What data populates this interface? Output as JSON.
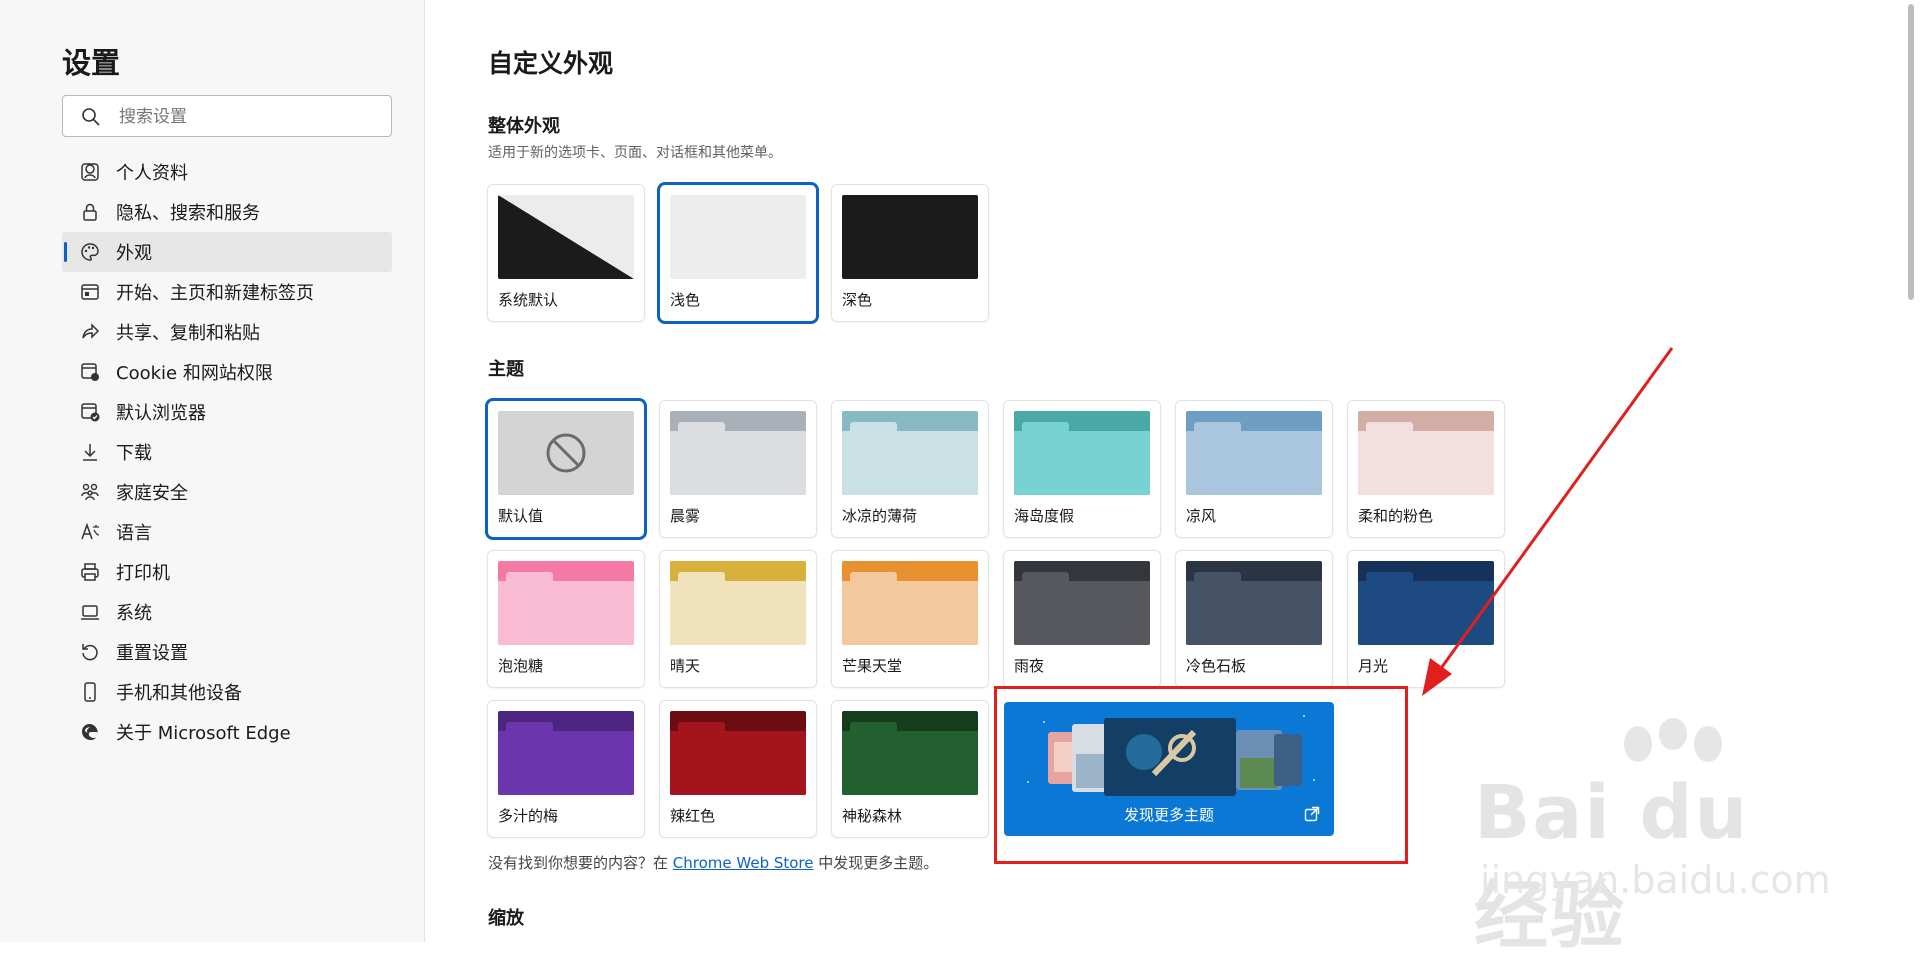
{
  "sidebar": {
    "title": "设置",
    "search_placeholder": "搜索设置",
    "items": [
      {
        "label": "个人资料",
        "icon": "profile-icon"
      },
      {
        "label": "隐私、搜索和服务",
        "icon": "lock-icon"
      },
      {
        "label": "外观",
        "icon": "palette-icon",
        "active": true
      },
      {
        "label": "开始、主页和新建标签页",
        "icon": "home-tab-icon"
      },
      {
        "label": "共享、复制和粘贴",
        "icon": "share-icon"
      },
      {
        "label": "Cookie 和网站权限",
        "icon": "cookie-permissions-icon"
      },
      {
        "label": "默认浏览器",
        "icon": "default-browser-icon"
      },
      {
        "label": "下载",
        "icon": "download-icon"
      },
      {
        "label": "家庭安全",
        "icon": "family-icon"
      },
      {
        "label": "语言",
        "icon": "language-icon"
      },
      {
        "label": "打印机",
        "icon": "printer-icon"
      },
      {
        "label": "系统",
        "icon": "system-icon"
      },
      {
        "label": "重置设置",
        "icon": "reset-icon"
      },
      {
        "label": "手机和其他设备",
        "icon": "phone-icon"
      },
      {
        "label": "关于 Microsoft Edge",
        "icon": "edge-logo-icon"
      }
    ]
  },
  "main": {
    "title": "自定义外观",
    "overall": {
      "title": "整体外观",
      "desc": "适用于新的选项卡、页面、对话框和其他菜单。",
      "options": [
        {
          "label": "系统默认"
        },
        {
          "label": "浅色",
          "selected": true
        },
        {
          "label": "深色"
        }
      ]
    },
    "themes": {
      "title": "主题",
      "items": [
        {
          "label": "默认值",
          "selected": true
        },
        {
          "label": "晨雾",
          "tab": "#aab0b7",
          "body": "#dcdde0"
        },
        {
          "label": "冰凉的薄荷",
          "tab": "#86b9c2",
          "body": "#c9e0e5"
        },
        {
          "label": "海岛度假",
          "tab": "#4aa9a5",
          "body": "#78d2d1"
        },
        {
          "label": "凉风",
          "tab": "#6e9ec4",
          "body": "#a9c6de"
        },
        {
          "label": "柔和的粉色",
          "tab": "#d3aea6",
          "body": "#f1e0df"
        },
        {
          "label": "泡泡糖",
          "tab": "#f47aa6",
          "body": "#f9bcd2"
        },
        {
          "label": "晴天",
          "tab": "#d8b13c",
          "body": "#f0e3bc"
        },
        {
          "label": "芒果天堂",
          "tab": "#e89130",
          "body": "#f2c89c"
        },
        {
          "label": "雨夜",
          "tab": "#33363b",
          "body": "#56585d"
        },
        {
          "label": "冷色石板",
          "tab": "#2b3444",
          "body": "#465367"
        },
        {
          "label": "月光",
          "tab": "#17325a",
          "body": "#1e4a82"
        },
        {
          "label": "多汁的梅",
          "tab": "#4b2580",
          "body": "#6b36ad"
        },
        {
          "label": "辣红色",
          "tab": "#6d0c12",
          "body": "#a3141c"
        },
        {
          "label": "神秘森林",
          "tab": "#143d1e",
          "body": "#22602f"
        }
      ],
      "discover": {
        "label": "发现更多主题"
      }
    },
    "hint": {
      "before": "没有找到你想要的内容？在 ",
      "link": "Chrome Web Store",
      "after": " 中发现更多主题。"
    },
    "zoom_title": "缩放"
  },
  "watermark": {
    "main": "Bai du 经验",
    "sub": "jingyan.baidu.com"
  },
  "colors": {
    "accent": "#0c63c4",
    "discover_bg": "#0a78d4",
    "annotation": "#e01f1f"
  }
}
